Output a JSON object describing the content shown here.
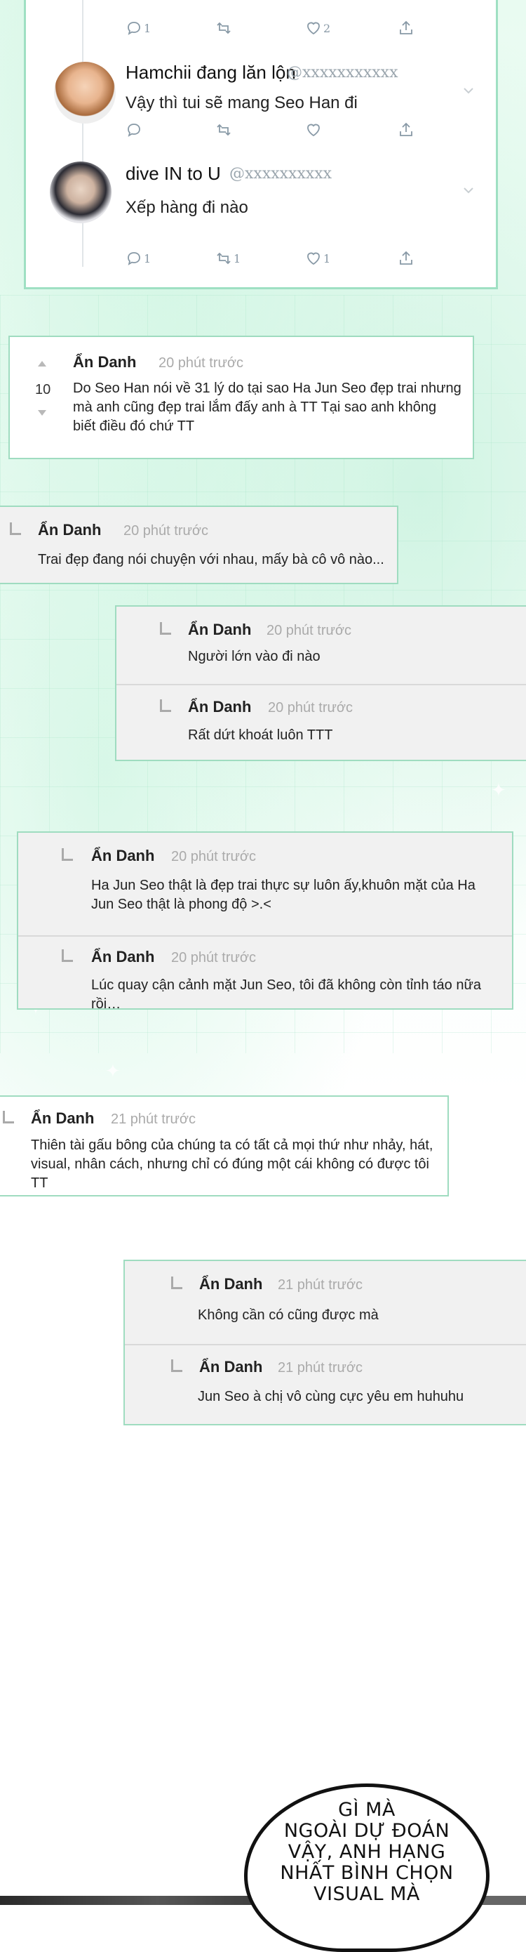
{
  "tweets": {
    "top_actions": {
      "reply_count": "1",
      "retweet_count": "",
      "like_count": "2"
    },
    "replies": [
      {
        "name": "Hamchii đang lăn lộn",
        "handle": "@xxxxxxxxxxx",
        "text": "Vậy thì tui sẽ mang Seo Han đi",
        "reply_count": "",
        "retweet_count": "",
        "like_count": ""
      },
      {
        "name": "dive IN to U",
        "handle": "@xxxxxxxxxx",
        "text": "Xếp hàng đi nào",
        "reply_count": "1",
        "retweet_count": "1",
        "like_count": "1"
      }
    ],
    "icons": [
      "reply-icon",
      "retweet-icon",
      "heart-icon",
      "share-icon",
      "chevron-down-icon"
    ]
  },
  "comments": [
    {
      "name": "Ẩn Danh",
      "time": "20 phút trước",
      "votes": "10",
      "lines": [
        "Do Seo Han nói về 31 lý do tại sao Ha Jun Seo đẹp trai nhưng",
        "mà anh cũng đẹp trai lắm đấy anh à TT Tại sao anh không",
        "biết điều đó chứ TT"
      ]
    },
    {
      "name": "Ẩn Danh",
      "time": "20 phút trước",
      "lines": [
        "Trai đẹp đang nói chuyện với nhau, mấy bà cô vô nào..."
      ]
    },
    {
      "replies": [
        {
          "name": "Ẩn Danh",
          "time": "20 phút trước",
          "lines": [
            "Người lớn vào đi nào"
          ]
        },
        {
          "name": "Ẩn Danh",
          "time": "20 phút trước",
          "lines": [
            "Rất dứt khoát luôn TTT"
          ]
        }
      ]
    },
    {
      "replies": [
        {
          "name": "Ẩn Danh",
          "time": "20 phút trước",
          "lines": [
            "Ha Jun Seo thật là đẹp trai thực sự luôn ấy,khuôn mặt của Ha",
            "Jun Seo thật là phong độ >.<"
          ]
        },
        {
          "name": "Ẩn Danh",
          "time": "20 phút trước",
          "lines": [
            "Lúc quay cận cảnh mặt Jun Seo, tôi đã không còn tỉnh táo nữa rồi…"
          ]
        }
      ]
    },
    {
      "name": "Ẩn Danh",
      "time": "21 phút trước",
      "lines": [
        "Thiên tài gấu bông của chúng ta có tất cả mọi thứ như nhảy, hát,",
        "visual, nhân cách, nhưng chỉ có đúng một cái không có được tôi TT"
      ]
    },
    {
      "replies": [
        {
          "name": "Ẩn Danh",
          "time": "21 phút trước",
          "lines": [
            "Không cần có cũng được mà"
          ]
        },
        {
          "name": "Ẩn Danh",
          "time": "21 phút trước",
          "lines": [
            "Jun Seo à chị vô cùng cực yêu em huhuhu"
          ]
        }
      ]
    }
  ],
  "speech_bubble": {
    "lines": [
      "GÌ MÀ",
      "NGOÀI DỰ ĐOÁN",
      "VẬY, ANH HẠNG",
      "NHẤT BÌNH CHỌN",
      "VISUAL MÀ"
    ]
  },
  "colors": {
    "accent_border": "#9fdcc0",
    "comment_bg": "#f1f1f1",
    "timestamp": "#aaaaaa",
    "twitter_icon": "#8899a6"
  }
}
